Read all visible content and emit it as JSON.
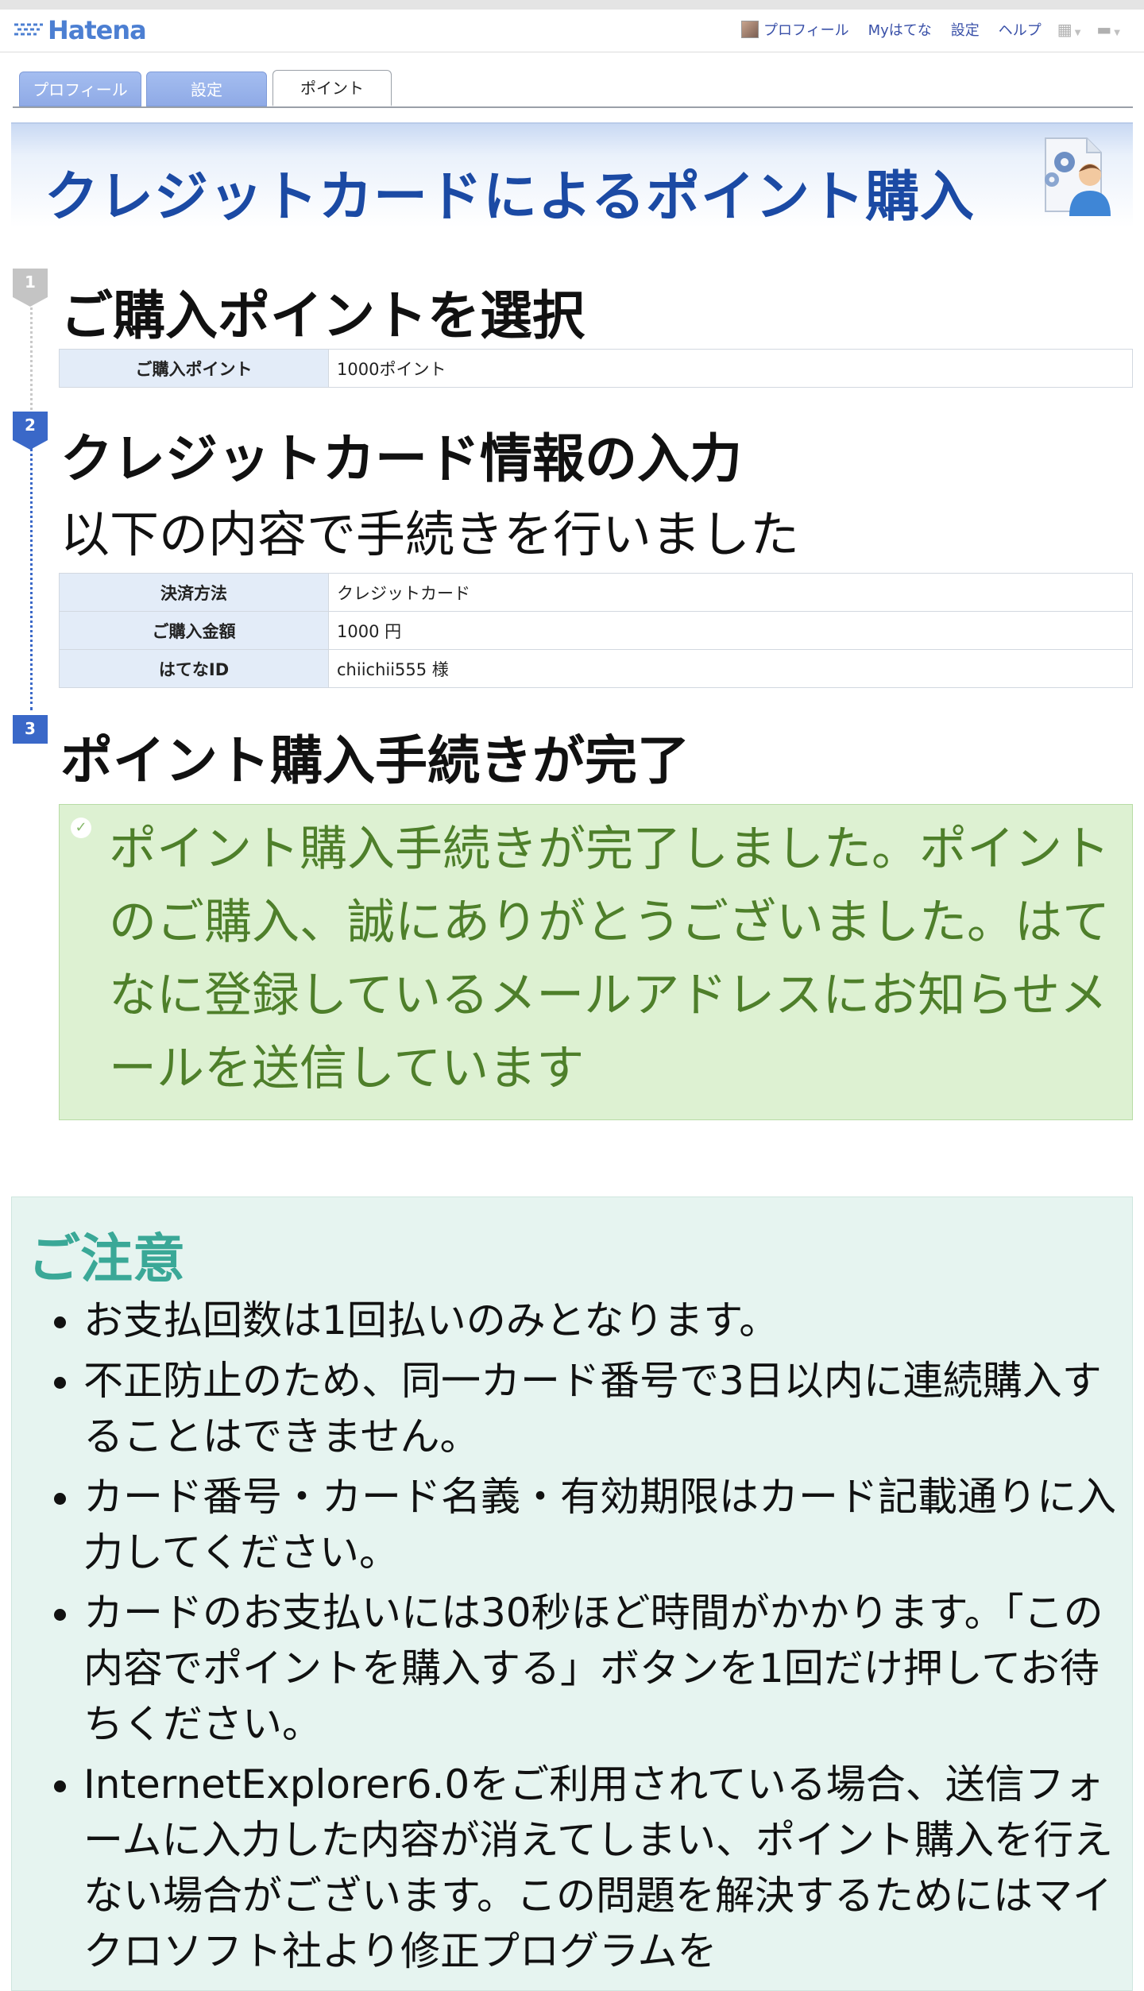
{
  "header": {
    "logo_text": "Hatena",
    "links": [
      {
        "label": "プロフィール"
      },
      {
        "label": "Myはてな"
      },
      {
        "label": "設定"
      },
      {
        "label": "ヘルプ"
      }
    ],
    "icons": [
      "avatar",
      "grid-icon",
      "comment-icon"
    ]
  },
  "tabs": [
    {
      "label": "プロフィール",
      "active": false
    },
    {
      "label": "設定",
      "active": false
    },
    {
      "label": "ポイント",
      "active": true
    }
  ],
  "page_title": "クレジットカードによるポイント購入",
  "steps": [
    {
      "number": "1",
      "heading": "ご購入ポイントを選択",
      "rows": [
        {
          "key": "ご購入ポイント",
          "value": "1000ポイント"
        }
      ]
    },
    {
      "number": "2",
      "heading": "クレジットカード情報の入力",
      "subheading": "以下の内容で手続きを行いました",
      "rows": [
        {
          "key": "決済方法",
          "value": "クレジットカード"
        },
        {
          "key": "ご購入金額",
          "value": "1000 円"
        },
        {
          "key": "はてなID",
          "value": "chiichii555 様"
        }
      ]
    },
    {
      "number": "3",
      "heading": "ポイント購入手続きが完了"
    }
  ],
  "success_message": "ポイント購入手続きが完了しました。ポイントのご購入、誠にありがとうございました。はてなに登録しているメールアドレスにお知らせメールを送信しています",
  "notice": {
    "title": "ご注意",
    "items": [
      "お支払回数は1回払いのみとなります。",
      "不正防止のため、同一カード番号で3日以内に連続購入することはできません。",
      "カード番号・カード名義・有効期限はカード記載通りに入力してください。",
      "カードのお支払いには30秒ほど時間がかかります。「この内容でポイントを購入する」ボタンを1回だけ押してお待ちください。",
      "InternetExplorer6.0をご利用されている場合、送信フォームに入力した内容が消えてしまい、ポイント購入を行えない場合がございます。この問題を解決するためにはマイクロソフト社より修正プログラムを"
    ]
  },
  "colors": {
    "title_blue": "#1b4aa4",
    "step_blue": "#3a68c8",
    "success_green": "#4e7f2a",
    "notice_teal": "#3aa897"
  }
}
